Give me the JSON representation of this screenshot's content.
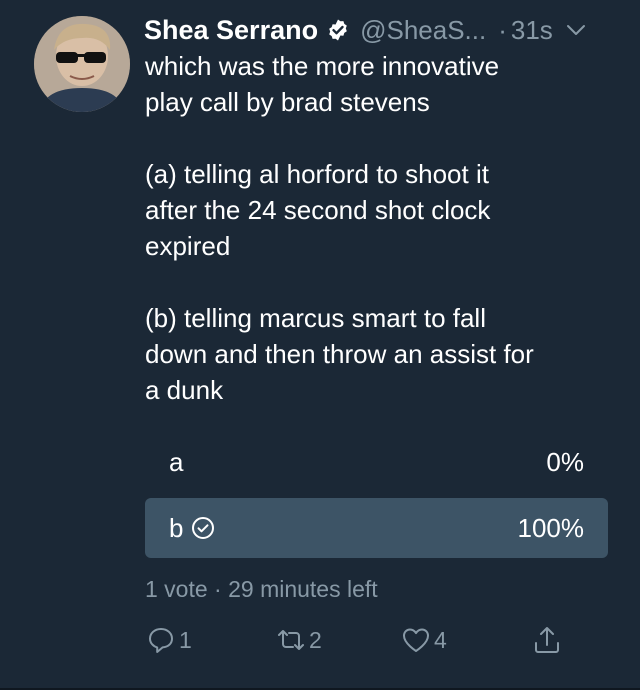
{
  "tweet": {
    "author_name": "Shea Serrano",
    "handle": "@SheaS...",
    "separator": "·",
    "time": "31s",
    "text": "which was the more innovative\nplay call by brad stevens\n\n(a) telling al horford to shoot it\nafter the 24 second shot clock\nexpired\n\n(b) telling marcus smart to fall\ndown and then throw an assist for\na dunk"
  },
  "poll": {
    "options": [
      {
        "label": "a",
        "percent": "0%"
      },
      {
        "label": "b",
        "percent": "100%",
        "selected": true
      }
    ],
    "meta": "1 vote · 29 minutes left"
  },
  "actions": {
    "reply_count": "1",
    "retweet_count": "2",
    "like_count": "4"
  },
  "icons": {
    "verified": "verified-badge-icon",
    "chevron": "chevron-down-icon",
    "check": "check-circle-icon",
    "reply": "reply-icon",
    "retweet": "retweet-icon",
    "like": "heart-icon",
    "share": "share-icon"
  },
  "colors": {
    "background": "#1b2836",
    "secondary_text": "#8899a6",
    "poll_fill": "#3d5466"
  }
}
